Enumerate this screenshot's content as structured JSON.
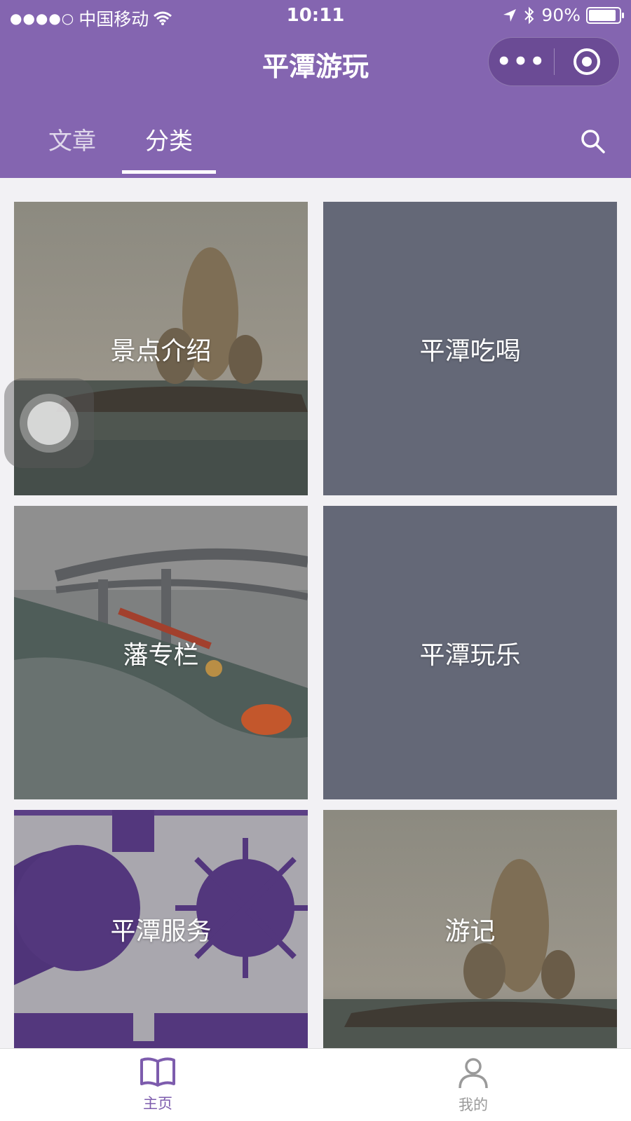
{
  "status_bar": {
    "carrier": "中国移动",
    "time": "10:11",
    "battery": "90%",
    "battery_level": 0.9
  },
  "header": {
    "title": "平潭游玩",
    "more_label": "•••"
  },
  "tabs": [
    {
      "label": "文章",
      "active": false
    },
    {
      "label": "分类",
      "active": true
    }
  ],
  "categories": [
    {
      "label": "景点介绍",
      "image": "rock-islet-photo"
    },
    {
      "label": "平潭吃喝",
      "image": "none"
    },
    {
      "label": "藩专栏",
      "image": "bridge-swimmer-photo"
    },
    {
      "label": "平潭玩乐",
      "image": "none"
    },
    {
      "label": "平潭服务",
      "image": "purple-logo-graphic"
    },
    {
      "label": "游记",
      "image": "rock-islet-photo"
    }
  ],
  "bottom_nav": [
    {
      "label": "主页",
      "icon": "book-icon",
      "active": true
    },
    {
      "label": "我的",
      "icon": "user-icon",
      "active": false
    }
  ],
  "colors": {
    "brand": "#8465b0",
    "tile_bg": "#646877",
    "active_tab": "#7d5cad",
    "inactive_tab": "#9a9a9a"
  }
}
